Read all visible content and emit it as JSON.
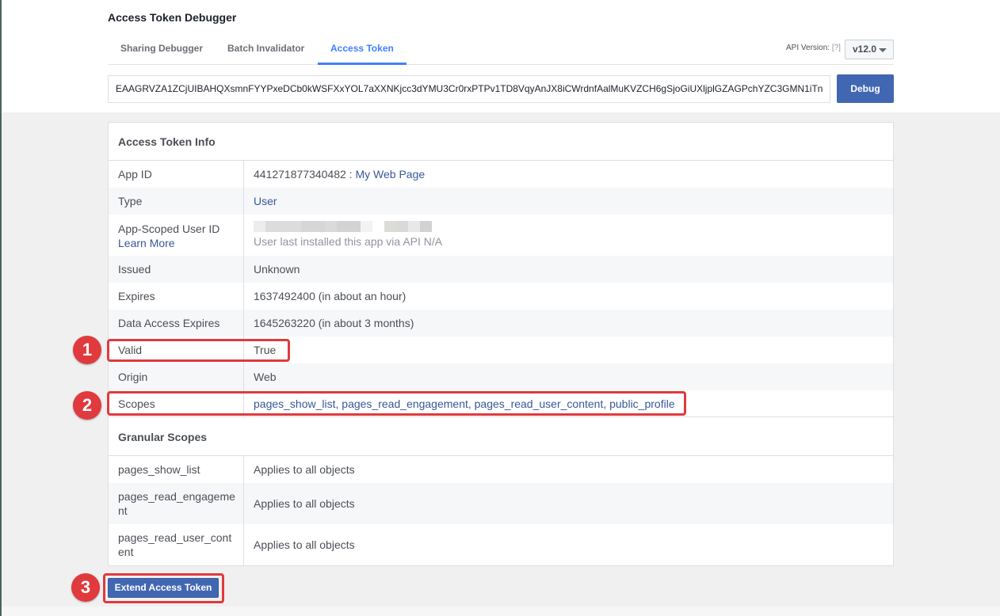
{
  "header": {
    "title": "Access Token Debugger",
    "tabs": [
      {
        "label": "Sharing Debugger",
        "active": false
      },
      {
        "label": "Batch Invalidator",
        "active": false
      },
      {
        "label": "Access Token",
        "active": true
      }
    ],
    "api_version_label": "API Version:",
    "api_help": "[?]",
    "api_version": "v12.0"
  },
  "token_input": {
    "value": "EAAGRVZA1ZCjUIBAHQXsmnFYYPxeDCb0kWSFXxYOL7aXXNKjcc3dYMU3Cr0rxPTPv1TD8VqyAnJX8iCWrdnfAalMuKVZCH6gSjoGiUXljplGZAGPchYZC3GMN1iTn"
  },
  "debug_button": "Debug",
  "access_token_info": {
    "heading": "Access Token Info",
    "app_id": {
      "label": "App ID",
      "id": "441271877340482",
      "separator": " : ",
      "name": "My Web Page"
    },
    "type": {
      "label": "Type",
      "value": "User"
    },
    "app_scoped_user_id": {
      "label": "App-Scoped User ID",
      "learn_more": "Learn More",
      "note": "User last installed this app via API N/A"
    },
    "issued": {
      "label": "Issued",
      "value": "Unknown"
    },
    "expires": {
      "label": "Expires",
      "value": "1637492400 (in about an hour)"
    },
    "data_access_expires": {
      "label": "Data Access Expires",
      "value": "1645263220 (in about 3 months)"
    },
    "valid": {
      "label": "Valid",
      "value": "True"
    },
    "origin": {
      "label": "Origin",
      "value": "Web"
    },
    "scopes": {
      "label": "Scopes",
      "value": "pages_show_list, pages_read_engagement, pages_read_user_content, public_profile"
    }
  },
  "granular_scopes": {
    "heading": "Granular Scopes",
    "rows": [
      {
        "scope": "pages_show_list",
        "target": "Applies to all objects"
      },
      {
        "scope": "pages_read_engageme\nnt",
        "target": "Applies to all objects"
      },
      {
        "scope": "pages_read_user_cont\nent",
        "target": "Applies to all objects"
      }
    ]
  },
  "extend_button": "Extend Access Token",
  "annotations": [
    "1",
    "2",
    "3"
  ],
  "colors": {
    "accent": "#4080ff",
    "button": "#4267b2",
    "link": "#385898",
    "annotation": "#e03a3e"
  }
}
